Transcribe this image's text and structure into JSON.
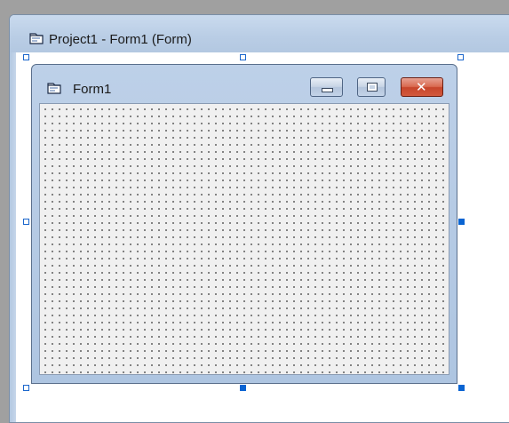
{
  "mdi_child": {
    "title": "Project1 - Form1 (Form)",
    "icon": "form-designer-icon"
  },
  "form": {
    "caption": "Form1",
    "icon": "form-icon",
    "buttons": {
      "minimize_icon": "minimize-icon",
      "maximize_icon": "maximize-icon",
      "close_icon": "close-icon",
      "close_glyph": "✕"
    },
    "grid": "dotted"
  },
  "selection": {
    "handle_color": "#0a64d2"
  }
}
